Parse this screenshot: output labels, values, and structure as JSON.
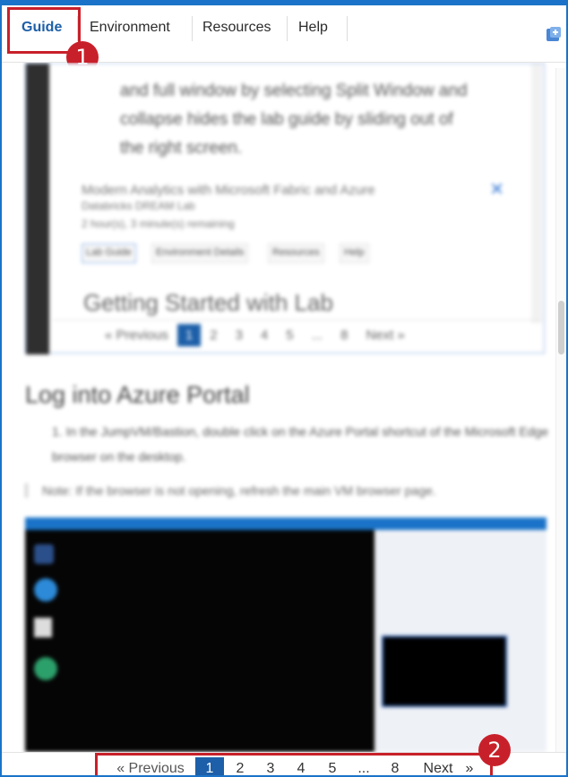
{
  "tabs": [
    {
      "label": "Guide",
      "active": true
    },
    {
      "label": "Environment",
      "active": false
    },
    {
      "label": "Resources",
      "active": false
    },
    {
      "label": "Help",
      "active": false
    }
  ],
  "callouts": {
    "first": "1",
    "second": "2"
  },
  "embedded_guide": {
    "paragraph_lines": [
      "and full window by selecting Split Window and",
      "collapse hides the lab guide by sliding out of",
      "the right screen."
    ],
    "lab_title_line1": "Modern Analytics with Microsoft Fabric and Azure",
    "lab_title_line2": "Databricks DREAM Lab",
    "time_remaining": "2 hour(s), 3 minute(s) remaining",
    "buttons": [
      "Lab Guide",
      "Environment Details",
      "Resources",
      "Help"
    ],
    "heading": "Getting Started with Lab",
    "pager": {
      "previous": "« Previous",
      "pages": [
        "1",
        "2",
        "3",
        "4",
        "5",
        "...",
        "8"
      ],
      "next": "Next »"
    }
  },
  "section": {
    "title": "Log into Azure Portal",
    "step": "1. In the JumpVM/Bastion, double click on the Azure Portal shortcut of the Microsoft Edge browser on the desktop.",
    "note": "Note: If the browser is not opening, refresh the main VM browser page."
  },
  "pager": {
    "previous": "« Previous",
    "pages": [
      "1",
      "2",
      "3",
      "4",
      "5",
      "...",
      "8"
    ],
    "current": "1",
    "next": "Next",
    "next_arrow": "»"
  },
  "colors": {
    "accent": "#1d5fa8",
    "callout": "#c8202a",
    "frame": "#1a73c8"
  }
}
